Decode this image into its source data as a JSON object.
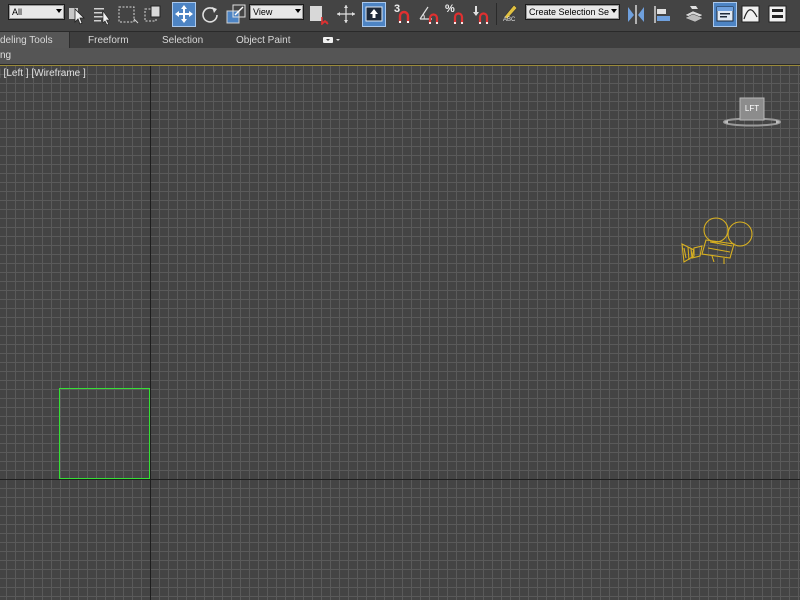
{
  "toolbar": {
    "selection_filter": "All",
    "reference_coord_system": "View",
    "snaps_toggle_label": "3",
    "percent_snap_label": "%",
    "edit_named_sets_label": "ABC",
    "named_selection_set": "Create Selection Se"
  },
  "ribbon": {
    "tabs": [
      {
        "label": "Modeling Tools",
        "visible_label": "deling Tools",
        "active": true
      },
      {
        "label": "Freeform"
      },
      {
        "label": "Selection"
      },
      {
        "label": "Object Paint"
      }
    ],
    "panel_label": "ng"
  },
  "viewport": {
    "label": "] [Left ] [Wireframe ]",
    "viewcube_face": "LFT"
  },
  "colors": {
    "background": "#444444",
    "grid": "#5a5a5a",
    "axis": "#1e1e1e",
    "active_button": "#4d84c4",
    "selected_object": "#35e035",
    "camera_object": "#d8b020",
    "viewport_border": "#9a8a3a"
  }
}
